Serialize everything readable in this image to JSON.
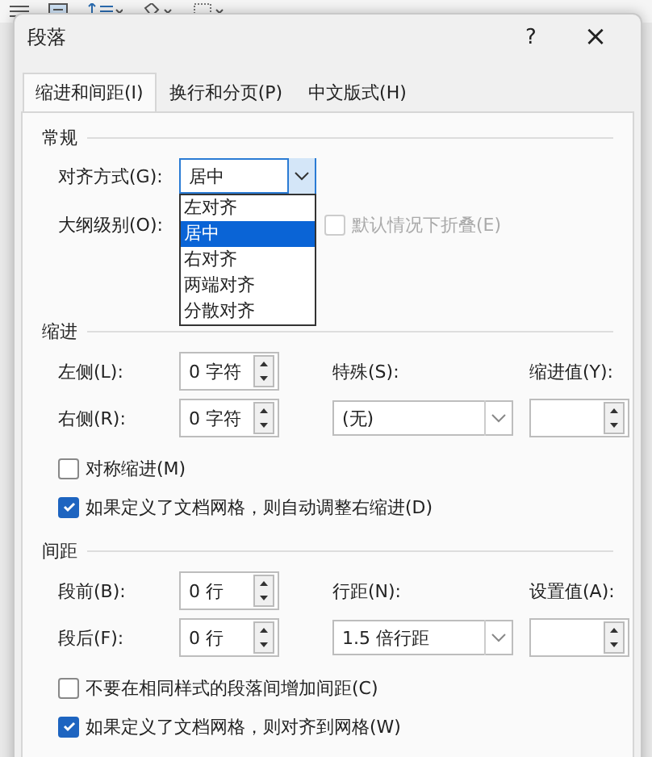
{
  "window": {
    "title": "段落",
    "help": "?",
    "close": "×"
  },
  "tabs": [
    {
      "label": "缩进和间距(I)",
      "selected": true
    },
    {
      "label": "换行和分页(P)",
      "selected": false
    },
    {
      "label": "中文版式(H)",
      "selected": false
    }
  ],
  "general": {
    "heading": "常规",
    "alignment": {
      "label": "对齐方式(G):",
      "value": "居中",
      "options": [
        {
          "label": "左对齐",
          "selected": false
        },
        {
          "label": "居中",
          "selected": true
        },
        {
          "label": "右对齐",
          "selected": false
        },
        {
          "label": "两端对齐",
          "selected": false
        },
        {
          "label": "分散对齐",
          "selected": false
        }
      ]
    },
    "outline": {
      "label": "大纲级别(O):"
    },
    "collapse": {
      "label": "默认情况下折叠(E)",
      "checked": false,
      "disabled": true
    }
  },
  "indent": {
    "heading": "缩进",
    "left": {
      "label": "左侧(L):",
      "value": "0 字符"
    },
    "right": {
      "label": "右侧(R):",
      "value": "0 字符"
    },
    "special": {
      "label": "特殊(S):",
      "value": "(无)"
    },
    "by": {
      "label": "缩进值(Y):"
    },
    "checks": [
      {
        "label": "对称缩进(M)",
        "checked": false,
        "disabled": false
      },
      {
        "label": "如果定义了文档网格，则自动调整右缩进(D)",
        "checked": true,
        "disabled": false
      }
    ]
  },
  "spacing": {
    "heading": "间距",
    "before": {
      "label": "段前(B):",
      "value": "0 行"
    },
    "after": {
      "label": "段后(F):",
      "value": "0 行"
    },
    "line": {
      "label": "行距(N):",
      "value": "1.5 倍行距"
    },
    "at": {
      "label": "设置值(A):"
    },
    "checks": [
      {
        "label": "不要在相同样式的段落间增加间距(C)",
        "checked": false,
        "disabled": false
      },
      {
        "label": "如果定义了文档网格，则对齐到网格(W)",
        "checked": true,
        "disabled": false
      }
    ]
  }
}
